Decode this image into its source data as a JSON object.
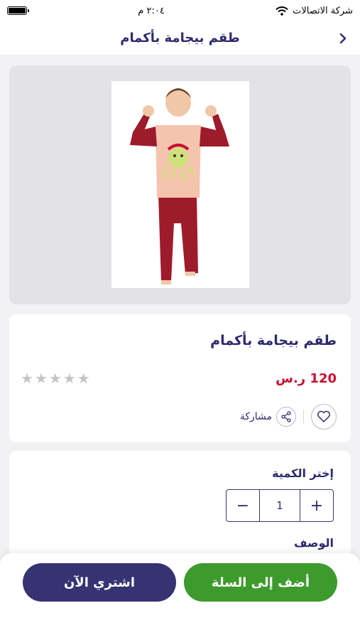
{
  "status_bar": {
    "carrier": "شركة الاتصالات",
    "time": "٢:٠٤ م"
  },
  "nav": {
    "title": "طقم بيجامة بأكمام"
  },
  "product": {
    "title": "طقم بيجامة بأكمام",
    "price": "120 ر.س",
    "rating": 0,
    "rating_max": 5,
    "share_label": "مشاركة"
  },
  "quantity": {
    "label": "إختر الكمية",
    "value": "1",
    "minus": "−",
    "plus": "+"
  },
  "description": {
    "label": "الوصف"
  },
  "buttons": {
    "add_to_cart": "أضف إلى السلة",
    "buy_now": "اشتري الآن"
  },
  "colors": {
    "primary": "#2e2a6e",
    "price": "#c8102e",
    "cart_green": "#3d9a2c",
    "buy_navy": "#363373"
  }
}
